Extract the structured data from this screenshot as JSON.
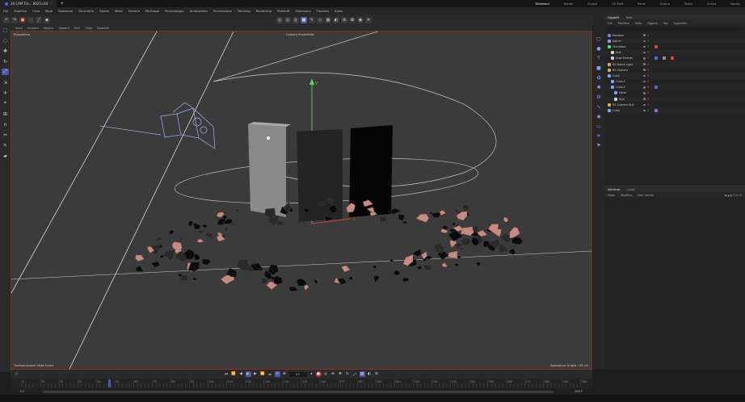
{
  "titlebar": {
    "tab_label": "30 CAM Tra... 8023.c4d",
    "tab_star": "*",
    "layouts": [
      "Standard",
      "Model",
      "Sculpt",
      "UV Edit",
      "Paint",
      "Groom",
      "Track",
      "Script",
      "Nodes"
    ]
  },
  "menubar": {
    "items": [
      "File",
      "Modifica",
      "Crea",
      "Modi",
      "Seleziona",
      "Strumenti",
      "Spline",
      "Mesh",
      "Volume",
      "MoGraph",
      "Personaggio",
      "Animazione",
      "Simulazione",
      "Tracking",
      "Rendering",
      "Redshift",
      "Estensioni",
      "Finestra",
      "Aiuto"
    ]
  },
  "viewport": {
    "menu": [
      "Vista",
      "Camere",
      "Mostra",
      "Opzioni",
      "Filtri",
      "Vista",
      "Redshift"
    ],
    "view_label": "Prospettiva",
    "camera_label": "Camera Predefinita",
    "bottom_left": "Trasformazione Vista Scena",
    "bottom_right": "Spaziatura Griglia : 50 cm",
    "axis_y": "Y",
    "axis_x": "X"
  },
  "object_manager": {
    "tabs": [
      "Oggetti",
      "Take"
    ],
    "menu": [
      "File",
      "Modifica",
      "Vista",
      "Oggetti",
      "Tag",
      "Segnalibri"
    ],
    "objects": [
      {
        "name": "Random",
        "indent": 0,
        "icon_color": "#8a7be0",
        "has_check": true,
        "tag": ""
      },
      {
        "name": "Spline",
        "indent": 0,
        "icon_color": "#7aa2ff",
        "has_check": true,
        "tag": ""
      },
      {
        "name": "Clonatore",
        "indent": 0,
        "icon_color": "#5fd08a",
        "has_check": true,
        "tag": "red"
      },
      {
        "name": "Null",
        "indent": 1,
        "icon_color": "#cfcfcf",
        "has_check": false,
        "tag": ""
      },
      {
        "name": "Dust Emitter",
        "indent": 1,
        "icon_color": "#cfcfcf",
        "has_check": false,
        "tag": "multi"
      },
      {
        "name": "RS Dome Light",
        "indent": 0,
        "icon_color": "#d8b04a",
        "has_check": false,
        "tag": ""
      },
      {
        "name": "RS Camera",
        "indent": 0,
        "icon_color": "#d8b04a",
        "has_check": false,
        "tag": ""
      },
      {
        "name": "Cubo",
        "indent": 0,
        "icon_color": "#7aa2ff",
        "has_check": false,
        "tag": ""
      },
      {
        "name": "Cubo.1",
        "indent": 1,
        "icon_color": "#7aa2ff",
        "has_check": false,
        "tag": ""
      },
      {
        "name": "Cubo.2",
        "indent": 1,
        "icon_color": "#7aa2ff",
        "has_check": false,
        "tag": "blue"
      },
      {
        "name": "Mesh",
        "indent": 2,
        "icon_color": "#7aa2ff",
        "has_check": false,
        "tag": ""
      },
      {
        "name": "Null",
        "indent": 2,
        "icon_color": "#cfcfcf",
        "has_check": false,
        "tag": ""
      },
      {
        "name": "RS Camera Null",
        "indent": 0,
        "icon_color": "#d8b04a",
        "has_check": false,
        "tag": ""
      },
      {
        "name": "Cubo",
        "indent": 0,
        "icon_color": "#7aa2ff",
        "has_check": true,
        "tag": "purple"
      }
    ]
  },
  "attribute_manager": {
    "tabs": [
      "Attributi",
      "Livelli"
    ],
    "menu": [
      "Modo",
      "Modifica",
      "Dati Utente"
    ]
  },
  "timeline": {
    "current_frame": "0 F",
    "start_frame": "0 F",
    "end_frame": "300 F",
    "ticks": [
      "0",
      "10",
      "20",
      "30",
      "40",
      "50",
      "60",
      "70",
      "80",
      "90",
      "100",
      "110",
      "120",
      "130",
      "140",
      "150",
      "160",
      "170",
      "180",
      "190",
      "200",
      "210",
      "220",
      "230",
      "240",
      "250",
      "260",
      "270",
      "280",
      "290",
      "300"
    ],
    "playhead_frame": 47
  },
  "colors": {
    "accent": "#4b5aa8",
    "record": "#c93535",
    "viewport_bg": "#3b3b3b",
    "active_border": "#8c2a2a"
  }
}
